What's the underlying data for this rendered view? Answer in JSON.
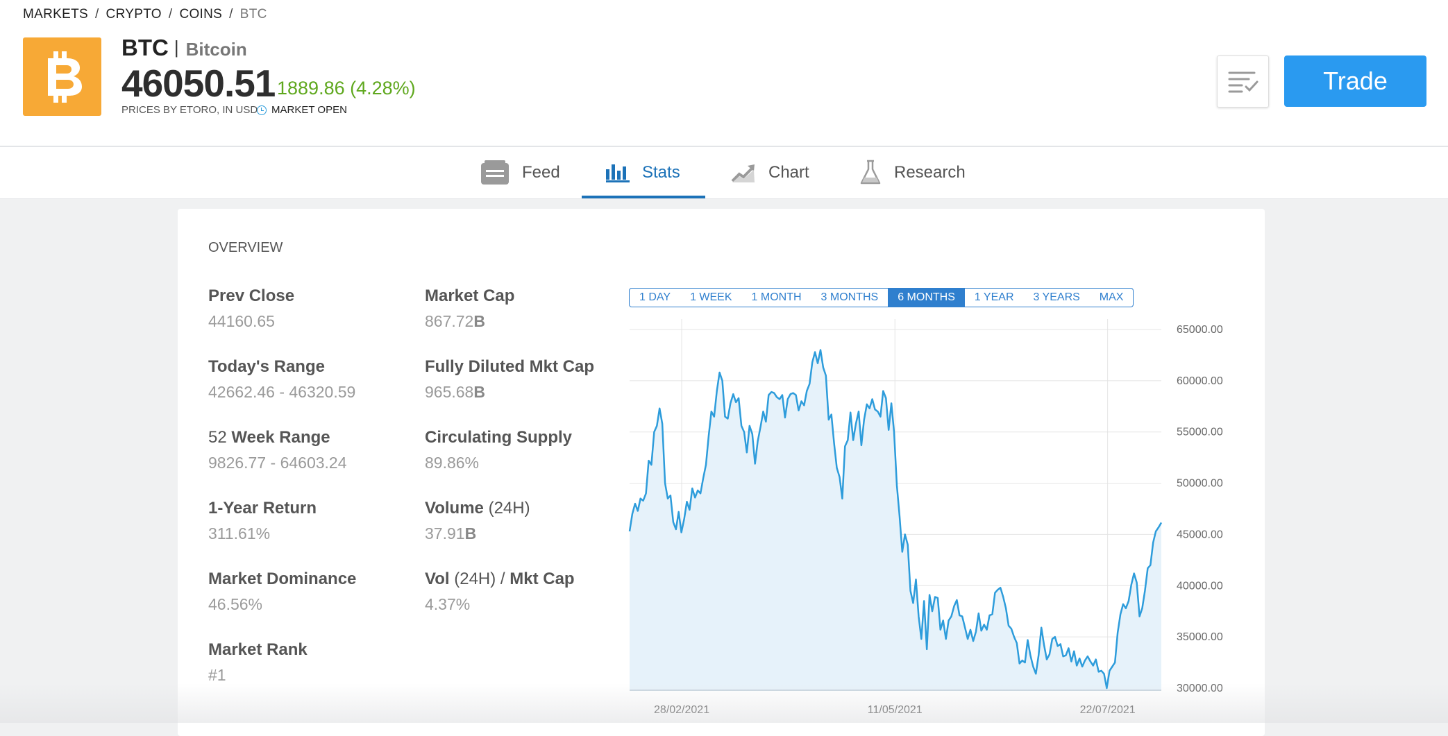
{
  "breadcrumb": [
    "MARKETS",
    "CRYPTO",
    "COINS",
    "BTC"
  ],
  "breadcrumb_sep": "/",
  "asset": {
    "symbol": "BTC",
    "divider": "|",
    "name": "Bitcoin",
    "price": "46050.51",
    "change": "1889.86 (4.28%)",
    "prices_by": "PRICES BY ETORO, IN USD",
    "market_status": "MARKET OPEN",
    "logo_icon": "bitcoin-icon",
    "logo_color": "#f7a936",
    "change_color": "#5fa81e"
  },
  "actions": {
    "watchlist_icon": "watchlist-check-icon",
    "trade_label": "Trade",
    "trade_color": "#2a9af0"
  },
  "tabs": [
    {
      "label": "Feed",
      "icon": "feed-icon",
      "active": false
    },
    {
      "label": "Stats",
      "icon": "stats-bar-icon",
      "active": true
    },
    {
      "label": "Chart",
      "icon": "chart-trend-icon",
      "active": false
    },
    {
      "label": "Research",
      "icon": "flask-icon",
      "active": false
    }
  ],
  "overview": {
    "title": "OVERVIEW",
    "stats_left": [
      {
        "label_bold": "Prev Close",
        "value": "44160.65"
      },
      {
        "label_bold": "Today's Range",
        "value": "42662.46 - 46320.59"
      },
      {
        "label_prefix": "52 ",
        "label_bold": "Week Range",
        "value": "9826.77 - 64603.24"
      },
      {
        "label_bold": "1-Year Return",
        "value": "311.61%"
      },
      {
        "label_bold": "Market Dominance",
        "value": "46.56%"
      },
      {
        "label_bold": "Market Rank",
        "value": "#1"
      }
    ],
    "stats_right": [
      {
        "label_bold": "Market Cap",
        "value": "867.72",
        "unit": "B"
      },
      {
        "label_bold": "Fully Diluted Mkt Cap",
        "value": "965.68",
        "unit": "B"
      },
      {
        "label_bold": "Circulating Supply",
        "value": "89.86%"
      },
      {
        "label_bold": "Volume",
        "label_suffix": " (24H)",
        "value": "37.91",
        "unit": "B"
      },
      {
        "label_bold": "Vol",
        "label_suffix": " (24H) / ",
        "label_bold2": "Mkt Cap",
        "value": "4.37%"
      }
    ]
  },
  "periods": [
    {
      "label": "1 DAY",
      "active": false
    },
    {
      "label": "1 WEEK",
      "active": false
    },
    {
      "label": "1 MONTH",
      "active": false
    },
    {
      "label": "3 MONTHS",
      "active": false
    },
    {
      "label": "6 MONTHS",
      "active": true
    },
    {
      "label": "1 YEAR",
      "active": false
    },
    {
      "label": "3 YEARS",
      "active": false
    },
    {
      "label": "MAX",
      "active": false
    }
  ],
  "chart_data": {
    "type": "area",
    "title": "",
    "xlabel": "",
    "ylabel": "",
    "ylim": [
      30000,
      65000
    ],
    "yticks": [
      "65000.00",
      "60000.00",
      "55000.00",
      "50000.00",
      "45000.00",
      "40000.00",
      "35000.00",
      "30000.00"
    ],
    "xticks": [
      "28/02/2021",
      "11/05/2021",
      "22/07/2021"
    ],
    "grid": true,
    "line_color": "#2d9cdb",
    "fill_color": "#e6f2fa",
    "series": [
      {
        "values": [
          45300,
          47000,
          48000,
          47300,
          48500,
          48300,
          49000,
          52200,
          51800,
          55000,
          55600,
          57300,
          55800,
          50000,
          48500,
          48800,
          46200,
          45500,
          47200,
          45200,
          46500,
          48200,
          47400,
          49500,
          48600,
          49300,
          49000,
          50500,
          51800,
          54600,
          57000,
          56500,
          59000,
          60800,
          60000,
          56500,
          56300,
          57800,
          58700,
          57900,
          58300,
          55600,
          55000,
          53000,
          55600,
          54800,
          51900,
          54100,
          55500,
          57000,
          56000,
          58600,
          58900,
          58800,
          58400,
          58200,
          58600,
          56400,
          58200,
          58700,
          58800,
          58600,
          57100,
          58000,
          57600,
          59000,
          59700,
          61800,
          62800,
          61700,
          63000,
          61300,
          60500,
          56200,
          56700,
          53900,
          51500,
          50600,
          48500,
          53600,
          54200,
          56900,
          54200,
          55800,
          57000,
          53700,
          56200,
          57700,
          57300,
          58200,
          57200,
          57000,
          56500,
          59000,
          58300,
          55200,
          57800,
          55000,
          49800,
          46800,
          43300,
          45000,
          44000,
          39500,
          38300,
          40600,
          37000,
          34800,
          38500,
          33800,
          39100,
          37500,
          38900,
          38800,
          35700,
          36600,
          34800,
          36600,
          37000,
          38000,
          38600,
          37100,
          37000,
          35900,
          34800,
          35700,
          34600,
          35500,
          37300,
          35600,
          36200,
          35700,
          37100,
          37200,
          39300,
          39600,
          39800,
          38900,
          37800,
          36100,
          35800,
          35000,
          34400,
          32400,
          32700,
          32500,
          34700,
          33200,
          32100,
          31400,
          33200,
          35900,
          34200,
          32800,
          33300,
          34800,
          35000,
          34100,
          34300,
          33100,
          33200,
          33900,
          32600,
          33600,
          32200,
          32900,
          32100,
          32700,
          33100,
          32600,
          32200,
          32800,
          31600,
          31700,
          31400,
          30000,
          31700,
          32100,
          32500,
          35400,
          37200,
          38200,
          37800,
          38500,
          40100,
          41200,
          40300,
          37000,
          37800,
          39500,
          41700,
          42000,
          44200,
          45300,
          45700,
          46150
        ]
      }
    ]
  }
}
